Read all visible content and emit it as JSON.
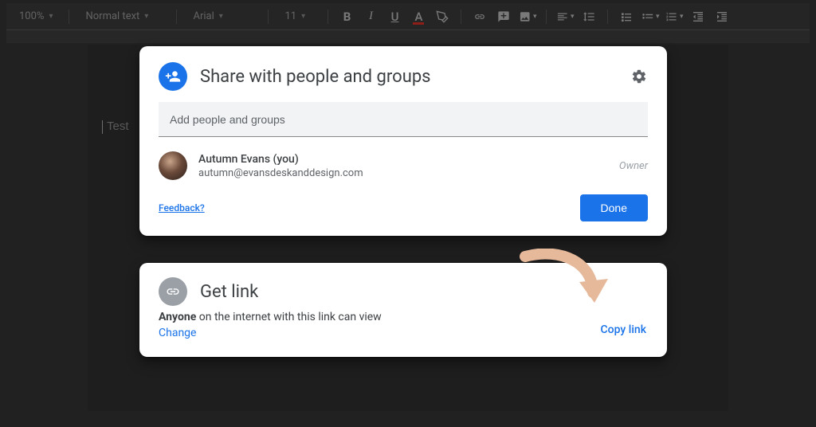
{
  "toolbar": {
    "zoom": "100%",
    "style": "Normal text",
    "font": "Arial",
    "size": "11"
  },
  "doc": {
    "text": "Test"
  },
  "share": {
    "title": "Share with people and groups",
    "placeholder": "Add people and groups",
    "person": {
      "name": "Autumn Evans (you)",
      "email": "autumn@evansdeskanddesign.com",
      "role": "Owner"
    },
    "feedback": "Feedback?",
    "done": "Done"
  },
  "link": {
    "title": "Get link",
    "desc_bold": "Anyone",
    "desc_rest": " on the internet with this link can view",
    "change": "Change",
    "copy": "Copy link"
  }
}
